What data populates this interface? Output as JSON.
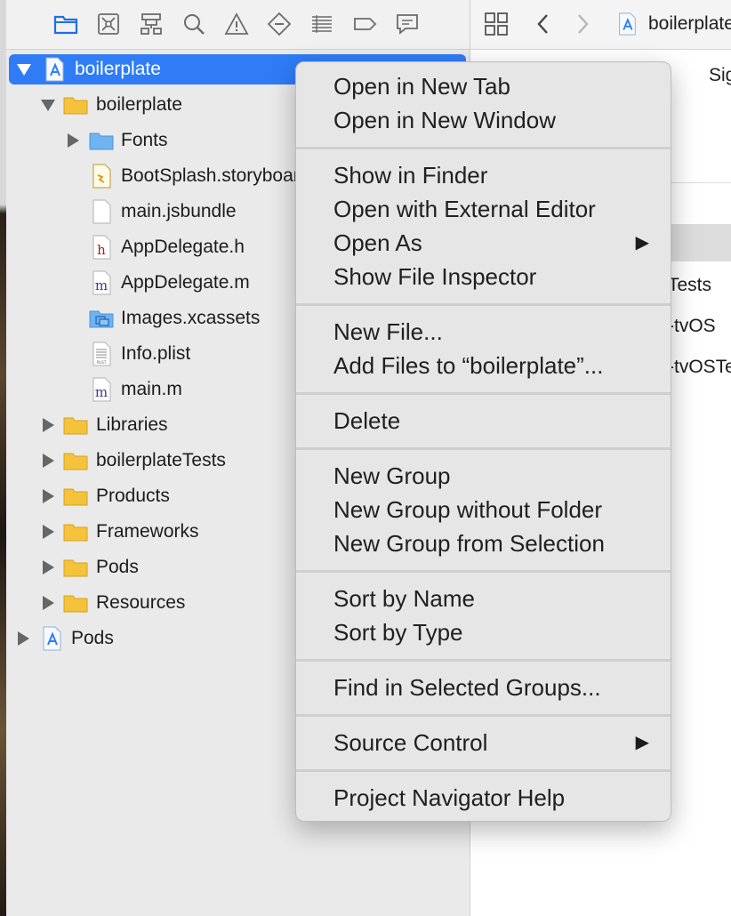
{
  "navigator": {
    "toolbar_icons": [
      "folder-icon",
      "source-control-icon",
      "hierarchy-icon",
      "search-icon",
      "warning-icon",
      "test-icon",
      "debug-icon",
      "breakpoint-icon",
      "report-icon"
    ],
    "tree": [
      {
        "label": "boilerplate",
        "icon": "xcode-project-icon",
        "expanded": true
      },
      {
        "label": "boilerplate",
        "icon": "yellow-folder-icon",
        "expanded": true
      },
      {
        "label": "Fonts",
        "icon": "blue-folder-icon",
        "expanded": false
      },
      {
        "label": "BootSplash.storyboard",
        "icon": "storyboard-file-icon"
      },
      {
        "label": "main.jsbundle",
        "icon": "blank-file-icon"
      },
      {
        "label": "AppDelegate.h",
        "icon": "header-file-icon",
        "glyph": "h"
      },
      {
        "label": "AppDelegate.m",
        "icon": "objc-file-icon",
        "glyph": "m"
      },
      {
        "label": "Images.xcassets",
        "icon": "asset-catalog-icon"
      },
      {
        "label": "Info.plist",
        "icon": "plist-file-icon",
        "glyph": "PLIST"
      },
      {
        "label": "main.m",
        "icon": "objc-file-icon",
        "glyph": "m"
      },
      {
        "label": "Libraries",
        "icon": "yellow-folder-icon",
        "expanded": false
      },
      {
        "label": "boilerplateTests",
        "icon": "yellow-folder-icon",
        "expanded": false
      },
      {
        "label": "Products",
        "icon": "yellow-folder-icon",
        "expanded": false
      },
      {
        "label": "Frameworks",
        "icon": "yellow-folder-icon",
        "expanded": false
      },
      {
        "label": "Pods",
        "icon": "yellow-folder-icon",
        "expanded": false
      },
      {
        "label": "Resources",
        "icon": "yellow-folder-icon",
        "expanded": false
      },
      {
        "label": "Pods",
        "icon": "xcode-project-icon",
        "expanded": false
      }
    ]
  },
  "editor": {
    "jump_bar_title": "boilerplate",
    "tab_partial": "Sig",
    "targets_partial": [
      "Tests",
      "-tvOS",
      "-tvOSTe"
    ]
  },
  "context_menu": {
    "groups": [
      [
        {
          "label": "Open in New Tab"
        },
        {
          "label": "Open in New Window"
        }
      ],
      [
        {
          "label": "Show in Finder"
        },
        {
          "label": "Open with External Editor"
        },
        {
          "label": "Open As",
          "submenu": true
        },
        {
          "label": "Show File Inspector"
        }
      ],
      [
        {
          "label": "New File..."
        },
        {
          "label": "Add Files to “boilerplate”..."
        }
      ],
      [
        {
          "label": "Delete"
        }
      ],
      [
        {
          "label": "New Group"
        },
        {
          "label": "New Group without Folder"
        },
        {
          "label": "New Group from Selection"
        }
      ],
      [
        {
          "label": "Sort by Name"
        },
        {
          "label": "Sort by Type"
        }
      ],
      [
        {
          "label": "Find in Selected Groups..."
        }
      ],
      [
        {
          "label": "Source Control",
          "submenu": true
        }
      ],
      [
        {
          "label": "Project Navigator Help"
        }
      ]
    ],
    "submenu_arrow": "▶"
  },
  "colors": {
    "selection": "#2f7cf6",
    "folder_yellow": "#f5c33b",
    "folder_blue": "#6fb3f2"
  }
}
